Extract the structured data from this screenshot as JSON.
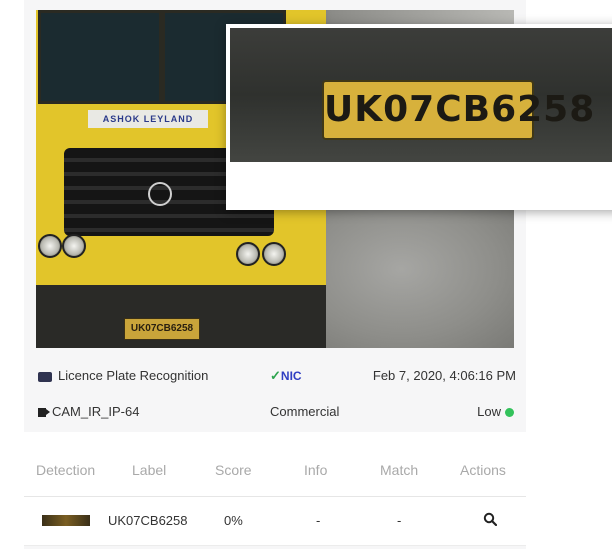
{
  "camera_image": {
    "truck_brand_text": "ASHOK LEYLAND",
    "plate_text": "UK07CB6258",
    "zoomed_plate_text": "UK07CB6258"
  },
  "event": {
    "category": "Licence Plate Recognition",
    "tag": "NIC",
    "timestamp": "Feb 7, 2020, 4:06:16 PM",
    "camera": "CAM_IR_IP-64",
    "vehicle_type": "Commercial",
    "priority": "Low",
    "priority_color": "#33c25b"
  },
  "table": {
    "columns": [
      "Detection",
      "Label",
      "Score",
      "Info",
      "Match",
      "Actions"
    ],
    "rows": [
      {
        "label": "UK07CB6258",
        "score": "0%",
        "info": "-",
        "match": "-",
        "action_icon": "search-icon"
      }
    ]
  }
}
